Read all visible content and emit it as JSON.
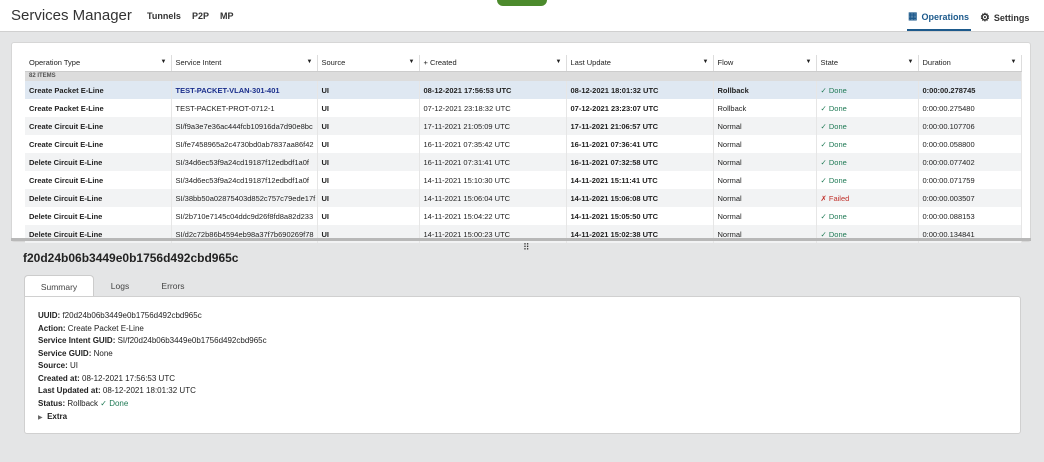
{
  "header": {
    "title": "Services Manager",
    "nav": [
      "Tunnels",
      "P2P",
      "MP"
    ],
    "operations": "Operations",
    "settings": "Settings"
  },
  "table": {
    "columns": [
      "Operation Type",
      "Service Intent",
      "Source",
      "+ Created",
      "Last Update",
      "Flow",
      "State",
      "Duration"
    ],
    "count": "82 ITEMS",
    "rows": [
      [
        "Create Packet E-Line",
        "TEST-PACKET-VLAN-301-401",
        "UI",
        "08-12-2021 17:56:53 UTC",
        "08-12-2021 18:01:32 UTC",
        "Rollback",
        "✓ Done",
        "0:00:00.278745"
      ],
      [
        "Create Packet E-Line",
        "TEST-PACKET-PROT-0712-1",
        "UI",
        "07-12-2021 23:18:32 UTC",
        "07-12-2021 23:23:07 UTC",
        "Rollback",
        "✓ Done",
        "0:00:00.275480"
      ],
      [
        "Create Circuit E-Line",
        "SI/f9a3e7e36ac444fcb10916da7d90e8bc",
        "UI",
        "17-11-2021 21:05:09 UTC",
        "17-11-2021 21:06:57 UTC",
        "Normal",
        "✓ Done",
        "0:00:00.107706"
      ],
      [
        "Create Circuit E-Line",
        "SI/fe7458965a2c4730bd0ab7837aa86f42",
        "UI",
        "16-11-2021 07:35:42 UTC",
        "16-11-2021 07:36:41 UTC",
        "Normal",
        "✓ Done",
        "0:00:00.058800"
      ],
      [
        "Delete Circuit E-Line",
        "SI/34d6ec53f9a24cd19187f12edbdf1a0f",
        "UI",
        "16-11-2021 07:31:41 UTC",
        "16-11-2021 07:32:58 UTC",
        "Normal",
        "✓ Done",
        "0:00:00.077402"
      ],
      [
        "Create Circuit E-Line",
        "SI/34d6ec53f9a24cd19187f12edbdf1a0f",
        "UI",
        "14-11-2021 15:10:30 UTC",
        "14-11-2021 15:11:41 UTC",
        "Normal",
        "✓ Done",
        "0:00:00.071759"
      ],
      [
        "Delete Circuit E-Line",
        "SI/38bb50a02875403d852c757c79ede17f",
        "UI",
        "14-11-2021 15:06:04 UTC",
        "14-11-2021 15:06:08 UTC",
        "Normal",
        "✗ Failed",
        "0:00:00.003507"
      ],
      [
        "Delete Circuit E-Line",
        "SI/2b710e7145c04ddc9d26f8fd8a82d233",
        "UI",
        "14-11-2021 15:04:22 UTC",
        "14-11-2021 15:05:50 UTC",
        "Normal",
        "✓ Done",
        "0:00:00.088153"
      ],
      [
        "Delete Circuit E-Line",
        "SI/d2c72b86b4594eb98a37f7b690269f78",
        "UI",
        "14-11-2021 15:00:23 UTC",
        "14-11-2021 15:02:38 UTC",
        "Normal",
        "✓ Done",
        "0:00:00.134841"
      ]
    ]
  },
  "detail": {
    "title": "f20d24b06b3449e0b1756d492cbd965c",
    "tabs": [
      "Summary",
      "Logs",
      "Errors"
    ],
    "fields": [
      {
        "label": "UUID:",
        "value": "f20d24b06b3449e0b1756d492cbd965c"
      },
      {
        "label": "Action:",
        "value": "Create Packet E-Line"
      },
      {
        "label": "Service Intent GUID:",
        "value": "SI/f20d24b06b3449e0b1756d492cbd965c"
      },
      {
        "label": "Service GUID:",
        "value": "None"
      },
      {
        "label": "Source:",
        "value": "UI"
      },
      {
        "label": "Created at:",
        "value": "08-12-2021 17:56:53 UTC"
      },
      {
        "label": "Last Updated at:",
        "value": "08-12-2021 18:01:32 UTC"
      },
      {
        "label": "Status:",
        "value": "Rollback",
        "extra": "✓ Done"
      }
    ],
    "extra": "Extra"
  }
}
